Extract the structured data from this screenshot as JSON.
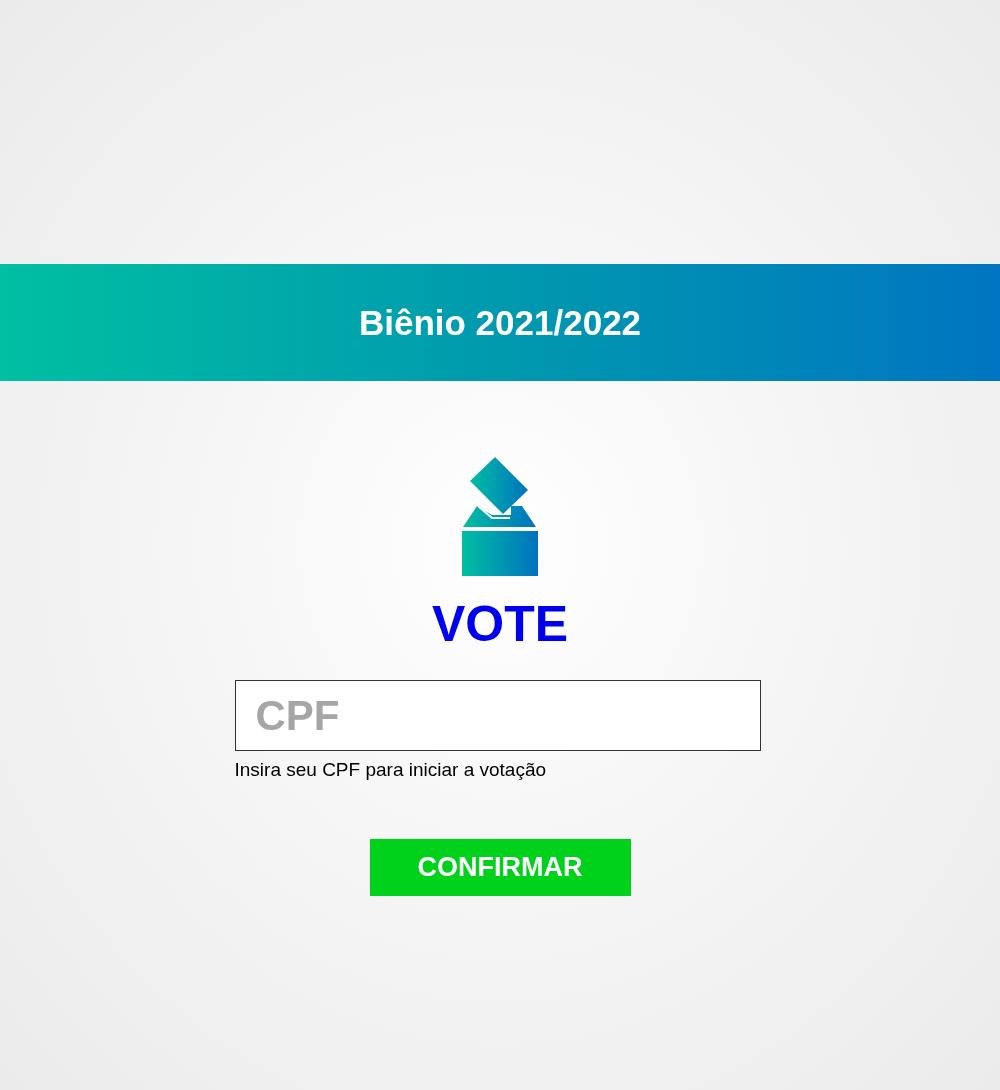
{
  "banner": {
    "title": "Biênio 2021/2022"
  },
  "heading": "VOTE",
  "cpf_field": {
    "placeholder": "CPF"
  },
  "hint": "Insira seu CPF para iniciar a votação",
  "buttons": [
    "CONFIRMAR"
  ]
}
